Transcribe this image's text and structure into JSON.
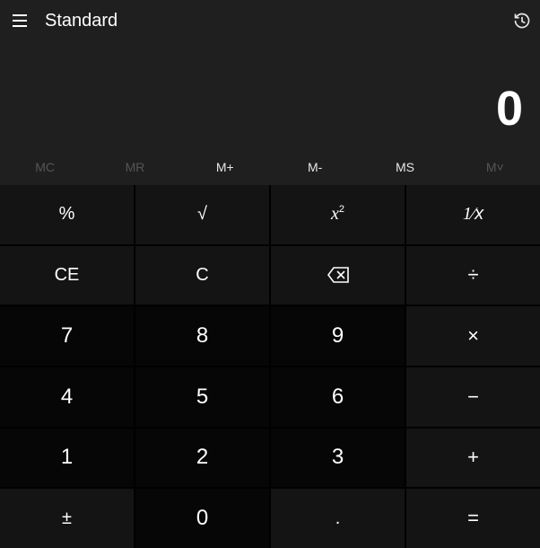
{
  "header": {
    "title": "Standard"
  },
  "display": {
    "value": "0"
  },
  "memory": {
    "mc": "MC",
    "mr": "MR",
    "mplus": "M+",
    "mminus": "M-",
    "ms": "MS",
    "mlist": "M˅",
    "disabled": {
      "mc": true,
      "mr": true,
      "mlist": true
    }
  },
  "keys": {
    "percent": "%",
    "sqrt": "√",
    "square": "x²",
    "reciprocal": "¹⁄ₓ",
    "ce": "CE",
    "c": "C",
    "backspace": "⌫",
    "divide": "÷",
    "seven": "7",
    "eight": "8",
    "nine": "9",
    "multiply": "×",
    "four": "4",
    "five": "5",
    "six": "6",
    "subtract": "−",
    "one": "1",
    "two": "2",
    "three": "3",
    "add": "+",
    "negate": "±",
    "zero": "0",
    "decimal": ".",
    "equals": "="
  }
}
